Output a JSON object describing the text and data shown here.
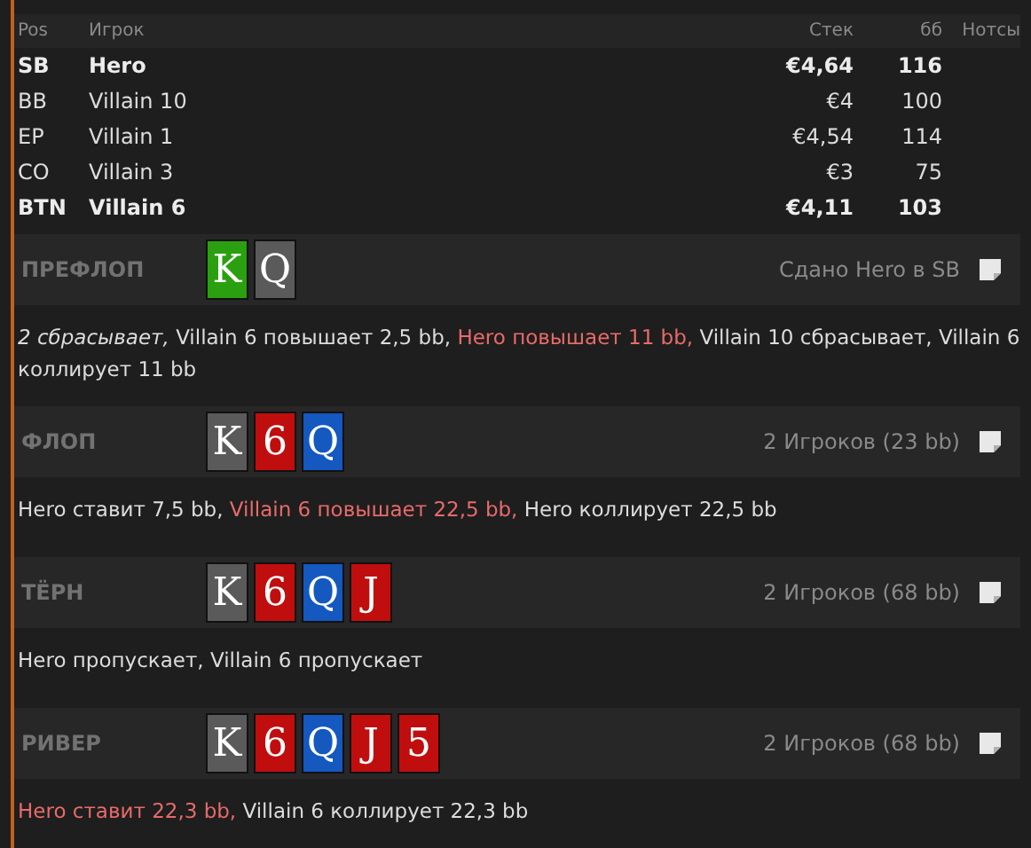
{
  "players": {
    "columns": [
      "Pos",
      "Игрок",
      "Стек",
      "бб",
      "Нотсы"
    ],
    "rows": [
      {
        "pos": "SB",
        "name": "Hero",
        "stack": "€4,64",
        "bb": "116",
        "bold": true
      },
      {
        "pos": "BB",
        "name": "Villain 10",
        "stack": "€4",
        "bb": "100",
        "bold": false
      },
      {
        "pos": "EP",
        "name": "Villain 1",
        "stack": "€4,54",
        "bb": "114",
        "bold": false
      },
      {
        "pos": "CO",
        "name": "Villain 3",
        "stack": "€3",
        "bb": "75",
        "bold": false
      },
      {
        "pos": "BTN",
        "name": "Villain 6",
        "stack": "€4,11",
        "bb": "103",
        "bold": true
      }
    ]
  },
  "streets": [
    {
      "name": "ПРЕФЛОП",
      "cards": [
        {
          "rank": "K",
          "color": "#2aa010"
        },
        {
          "rank": "Q",
          "color": "#5a5a5a"
        }
      ],
      "info": "Сдано Hero в SB",
      "actions": [
        {
          "kind": "italic",
          "text": "2 сбрасывает,"
        },
        {
          "kind": "normal",
          "text": "Villain 6 повышает 2,5 bb,"
        },
        {
          "kind": "hero",
          "text": "Hero повышает 11 bb,"
        },
        {
          "kind": "normal",
          "text": "Villain 10 сбрасывает, Villain 6 коллирует 11 bb"
        }
      ]
    },
    {
      "name": "ФЛОП",
      "cards": [
        {
          "rank": "K",
          "color": "#5a5a5a"
        },
        {
          "rank": "6",
          "color": "#c00e0e"
        },
        {
          "rank": "Q",
          "color": "#1458c0"
        }
      ],
      "info": "2 Игроков (23 bb)",
      "actions": [
        {
          "kind": "normal",
          "text": "Hero ставит 7,5 bb,"
        },
        {
          "kind": "hero",
          "text": "Villain 6 повышает 22,5 bb,"
        },
        {
          "kind": "normal",
          "text": "Hero коллирует 22,5 bb"
        }
      ]
    },
    {
      "name": "ТЁРН",
      "cards": [
        {
          "rank": "K",
          "color": "#5a5a5a"
        },
        {
          "rank": "6",
          "color": "#c00e0e"
        },
        {
          "rank": "Q",
          "color": "#1458c0"
        },
        {
          "rank": "J",
          "color": "#c00e0e"
        }
      ],
      "info": "2 Игроков (68 bb)",
      "actions": [
        {
          "kind": "normal",
          "text": "Hero пропускает, Villain 6 пропускает"
        }
      ]
    },
    {
      "name": "РИВЕР",
      "cards": [
        {
          "rank": "K",
          "color": "#5a5a5a"
        },
        {
          "rank": "6",
          "color": "#c00e0e"
        },
        {
          "rank": "Q",
          "color": "#1458c0"
        },
        {
          "rank": "J",
          "color": "#c00e0e"
        },
        {
          "rank": "5",
          "color": "#c00e0e"
        }
      ],
      "info": "2 Игроков (68 bb)",
      "actions": [
        {
          "kind": "hero",
          "text": "Hero ставит 22,3 bb,"
        },
        {
          "kind": "normal",
          "text": "Villain 6 коллирует 22,3 bb"
        }
      ]
    }
  ]
}
